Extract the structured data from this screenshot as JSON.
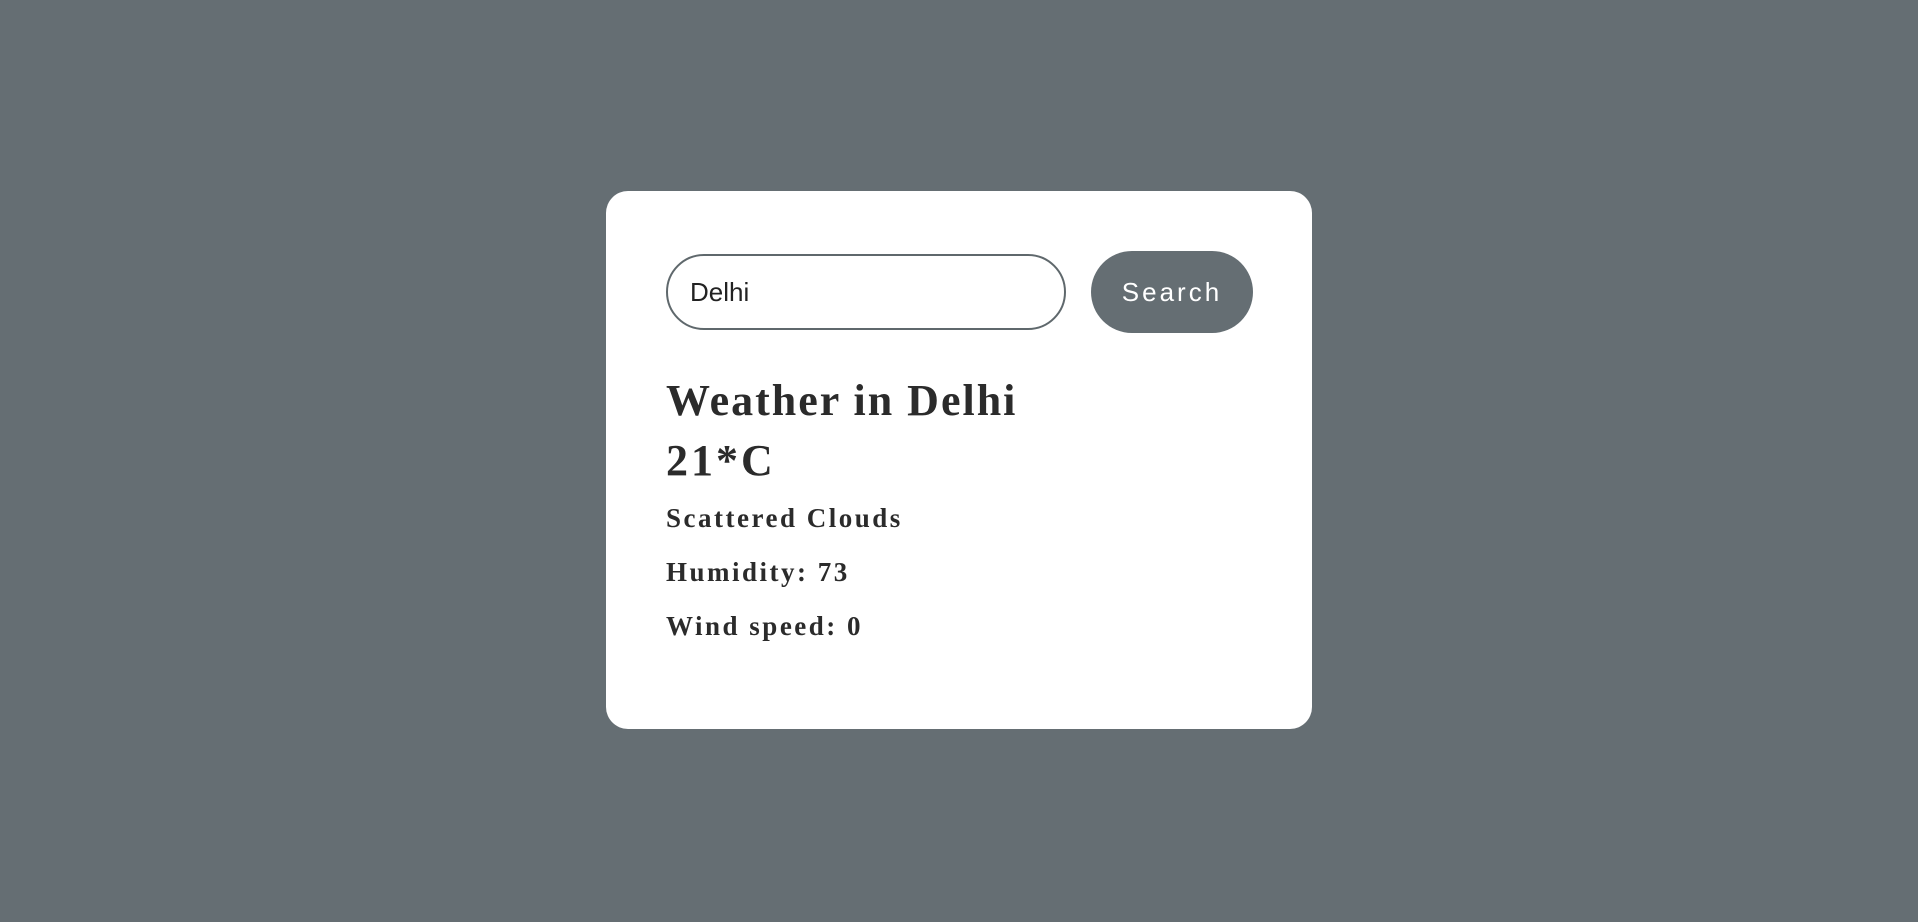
{
  "search": {
    "value": "Delhi",
    "button_label": "Search"
  },
  "weather": {
    "city_heading": "Weather in Delhi",
    "temperature": "21*C",
    "description": "Scattered Clouds",
    "humidity": "Humidity: 73",
    "wind_speed": "Wind speed: 0"
  },
  "colors": {
    "background": "#656e73",
    "card": "#ffffff",
    "button": "#656e73",
    "text": "#2b2b2b"
  }
}
